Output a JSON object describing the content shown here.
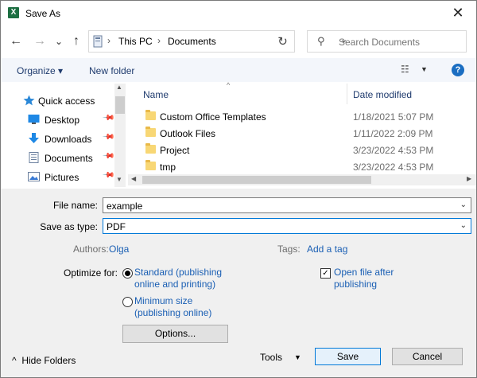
{
  "window": {
    "title": "Save As",
    "app_icon": "excel-icon",
    "close_glyph": "✕"
  },
  "nav": {
    "back_glyph": "←",
    "forward_glyph": "→",
    "recent_glyph": "⌄",
    "up_glyph": "↑",
    "breadcrumbs": [
      "This PC",
      "Documents"
    ],
    "crumb_sep": "›",
    "refresh_glyph": "↻",
    "search_placeholder": "Search Documents"
  },
  "toolbar": {
    "organize_label": "Organize ▾",
    "new_folder_label": "New folder",
    "view_glyph": "☷",
    "view_dd": "▼",
    "help_glyph": "?"
  },
  "nav_pane": {
    "items": [
      {
        "label": "Quick access",
        "icon": "star-icon",
        "pinned": false
      },
      {
        "label": "Desktop",
        "icon": "desktop-icon",
        "pinned": true
      },
      {
        "label": "Downloads",
        "icon": "download-icon",
        "pinned": true
      },
      {
        "label": "Documents",
        "icon": "document-icon",
        "pinned": true
      },
      {
        "label": "Pictures",
        "icon": "picture-icon",
        "pinned": true
      }
    ],
    "pin_glyph": "📌"
  },
  "file_list": {
    "columns": {
      "name": "Name",
      "date": "Date modified"
    },
    "rows": [
      {
        "name": "Custom Office Templates",
        "date": "1/18/2021 5:07 PM"
      },
      {
        "name": "Outlook Files",
        "date": "1/11/2022 2:09 PM"
      },
      {
        "name": "Project",
        "date": "3/23/2022 4:53 PM"
      },
      {
        "name": "tmp",
        "date": "3/23/2022 4:53 PM"
      }
    ]
  },
  "form": {
    "file_name_label": "File name:",
    "file_name_value": "example",
    "save_type_label": "Save as type:",
    "save_type_value": "PDF",
    "authors_label": "Authors:",
    "authors_value": "Olga",
    "tags_label": "Tags:",
    "tags_value": "Add a tag",
    "optimize_label": "Optimize for:",
    "opt_standard_line1": "Standard (publishing",
    "opt_standard_line2": "online and printing)",
    "opt_minimum_line1": "Minimum size",
    "opt_minimum_line2": "(publishing online)",
    "open_after_line1": "Open file after",
    "open_after_line2": "publishing",
    "open_after_checked": true,
    "options_button": "Options...",
    "hide_folders": "Hide Folders",
    "tools": "Tools",
    "tools_dd": "▼",
    "save_button": "Save",
    "cancel_button": "Cancel",
    "check_glyph": "✓",
    "hide_glyph": "^"
  },
  "colors": {
    "accent": "#0078d7",
    "link": "#1a5fb4",
    "toolbar_bg": "#f3f6fb",
    "form_bg": "#f0f0f0"
  }
}
